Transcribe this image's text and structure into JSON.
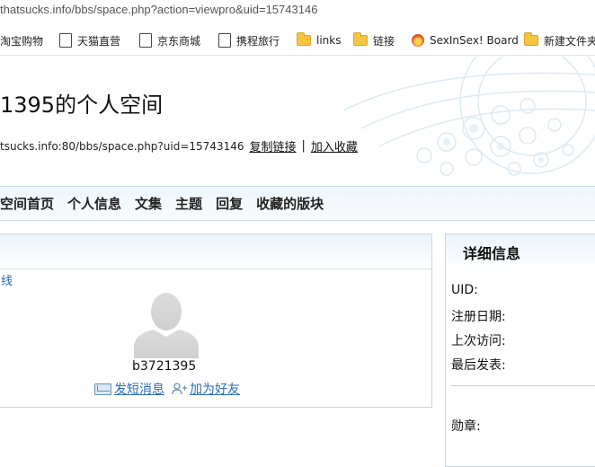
{
  "browser": {
    "url": "thatsucks.info/bbs/space.php?action=viewpro&uid=15743146"
  },
  "bookmarks": [
    {
      "label": "淘宝购物",
      "icon": "page-icon"
    },
    {
      "label": "天猫直营",
      "icon": "page-icon"
    },
    {
      "label": "京东商城",
      "icon": "page-icon"
    },
    {
      "label": "携程旅行",
      "icon": "page-icon"
    },
    {
      "label": "links",
      "icon": "folder-icon"
    },
    {
      "label": "链接",
      "icon": "folder-icon"
    },
    {
      "label": "SexInSex! Board",
      "icon": "flame-icon"
    },
    {
      "label": "新建文件夹",
      "icon": "folder-icon"
    }
  ],
  "header": {
    "title": "1395的个人空间",
    "space_url": "tsucks.info:80/bbs/space.php?uid=15743146",
    "copy_link": "复制链接",
    "separator": "|",
    "add_favorite": "加入收藏"
  },
  "nav": {
    "items": [
      "空间首页",
      "个人信息",
      "文集",
      "主题",
      "回复",
      "收藏的版块"
    ]
  },
  "profile": {
    "status": "线",
    "username": "b3721395",
    "send_message": "发短消息",
    "add_friend": "加为好友"
  },
  "details": {
    "title": "详细信息",
    "uid_label": "UID:",
    "reg_date_label": "注册日期:",
    "last_visit_label": "上次访问:",
    "last_post_label": "最后发表:",
    "medals_label": "勋章:"
  }
}
